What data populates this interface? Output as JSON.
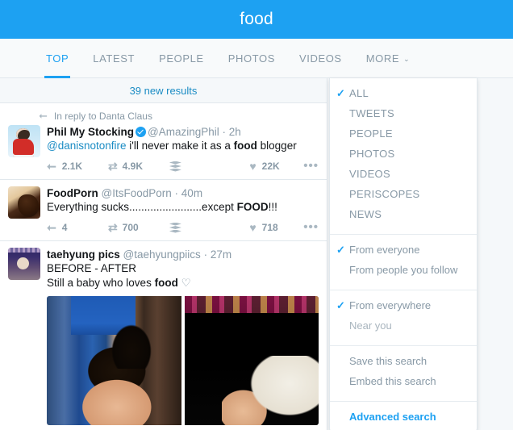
{
  "header": {
    "title": "food"
  },
  "tabs": [
    {
      "label": "TOP",
      "active": true
    },
    {
      "label": "LATEST",
      "active": false
    },
    {
      "label": "PEOPLE",
      "active": false
    },
    {
      "label": "PHOTOS",
      "active": false
    },
    {
      "label": "VIDEOS",
      "active": false
    },
    {
      "label": "MORE",
      "active": false,
      "chevron": "⌄"
    }
  ],
  "stream": {
    "new_results_label": "39 new results",
    "tweets": [
      {
        "context": "In reply to Danta Claus",
        "fullname": "Phil My Stocking",
        "verified": true,
        "handle": "@AmazingPhil",
        "separator": "·",
        "time": "2h",
        "text_mention": "@danisnotonfire",
        "text_before": " i'll never make it as a ",
        "text_highlight": "food",
        "text_after": " blogger",
        "actions": {
          "reply_count": "2.1K",
          "retweet_count": "4.9K",
          "buffer_count": "",
          "like_count": "22K"
        }
      },
      {
        "context": "",
        "fullname": "FoodPorn",
        "verified": false,
        "handle": "@ItsFoodPorn",
        "separator": "·",
        "time": "40m",
        "text_plain": "Everything sucks........................except ",
        "text_highlight": "FOOD",
        "text_after": "!!!",
        "actions": {
          "reply_count": "4",
          "retweet_count": "700",
          "buffer_count": "",
          "like_count": "718"
        }
      },
      {
        "context": "",
        "fullname": "taehyung pics",
        "verified": false,
        "handle": "@taehyungpiics",
        "separator": "·",
        "time": "27m",
        "line1": "BEFORE - AFTER",
        "line2_before": "Still a baby who loves ",
        "text_highlight": "food",
        "line2_after": " ♡",
        "photo_left_alt": "child-haircut-photo",
        "photo_right_alt": "person-arm-photo"
      }
    ]
  },
  "dropdown": {
    "groups": [
      {
        "items": [
          {
            "label": "ALL",
            "checked": true
          },
          {
            "label": "TWEETS",
            "checked": false
          },
          {
            "label": "PEOPLE",
            "checked": false
          },
          {
            "label": "PHOTOS",
            "checked": false
          },
          {
            "label": "VIDEOS",
            "checked": false
          },
          {
            "label": "PERISCOPES",
            "checked": false
          },
          {
            "label": "NEWS",
            "checked": false
          }
        ]
      },
      {
        "items": [
          {
            "label": "From everyone",
            "checked": true
          },
          {
            "label": "From people you follow",
            "checked": false
          }
        ]
      },
      {
        "items": [
          {
            "label": "From everywhere",
            "checked": true
          },
          {
            "label": "Near you",
            "checked": false
          }
        ]
      },
      {
        "items": [
          {
            "label": "Save this search",
            "checked": false
          },
          {
            "label": "Embed this search",
            "checked": false
          }
        ]
      },
      {
        "items": [
          {
            "label": "Advanced search",
            "checked": false,
            "accent": true
          }
        ]
      }
    ],
    "check_glyph": "✓"
  },
  "colors": {
    "brand_blue": "#1da1f2",
    "link_blue": "#1b8cc4",
    "muted": "#8899a6",
    "text": "#14171a",
    "page_bg": "#f5f8fa",
    "border": "#e1e8ed"
  },
  "icons": {
    "reply": "➦",
    "retweet": "⇄",
    "heart": "♥",
    "dots": "•••",
    "chevron_down": "⌄"
  }
}
